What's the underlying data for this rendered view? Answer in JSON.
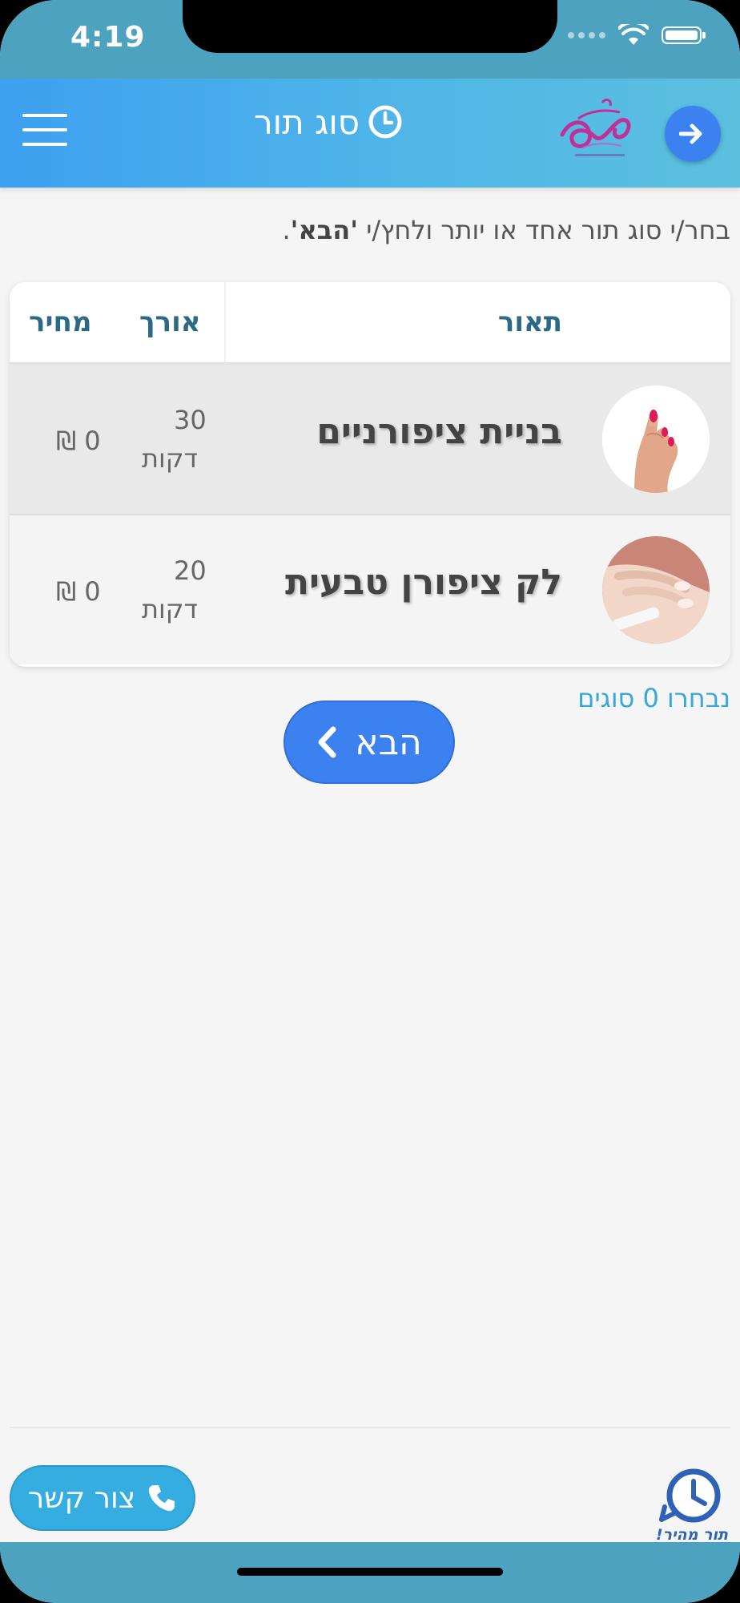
{
  "status_bar": {
    "time": "4:19"
  },
  "header": {
    "title": "סוג תור",
    "menu_icon": "hamburger-menu-icon",
    "title_icon": "clock-icon",
    "logo": "salon-logo",
    "forward_icon": "arrow-right-icon"
  },
  "instruction": {
    "text_before": "בחר/י סוג תור אחד או יותר ולחץ/י",
    "emphasis": "'הבא'",
    "text_after": "."
  },
  "table": {
    "columns": {
      "description": "תאור",
      "length": "אורך",
      "price": "מחיר"
    },
    "rows": [
      {
        "name": "בניית ציפורניים",
        "duration": "30",
        "unit": "דקות",
        "price": "0 ₪",
        "thumb": "manicure-hand-image"
      },
      {
        "name": "לק ציפורן טבעית",
        "duration": "20",
        "unit": "דקות",
        "price": "0 ₪",
        "thumb": "nail-filing-image"
      }
    ]
  },
  "selected_count": "נבחרו 0 סוגים",
  "next_button": {
    "label": "הבא",
    "icon": "chevron-left-icon"
  },
  "footer": {
    "contact_label": "צור קשר",
    "contact_icon": "phone-icon",
    "quick_appointment_label": "תור מהיר!",
    "quick_appointment_icon": "quick-clock-icon"
  },
  "colors": {
    "header_start": "#3da0f0",
    "header_end": "#5bc0de",
    "status_bar": "#4da3bf",
    "primary_button": "#3b82f0",
    "contact_button": "#35ade0",
    "column_header_text": "#2b6a87",
    "selected_count_text": "#35a9dc"
  }
}
